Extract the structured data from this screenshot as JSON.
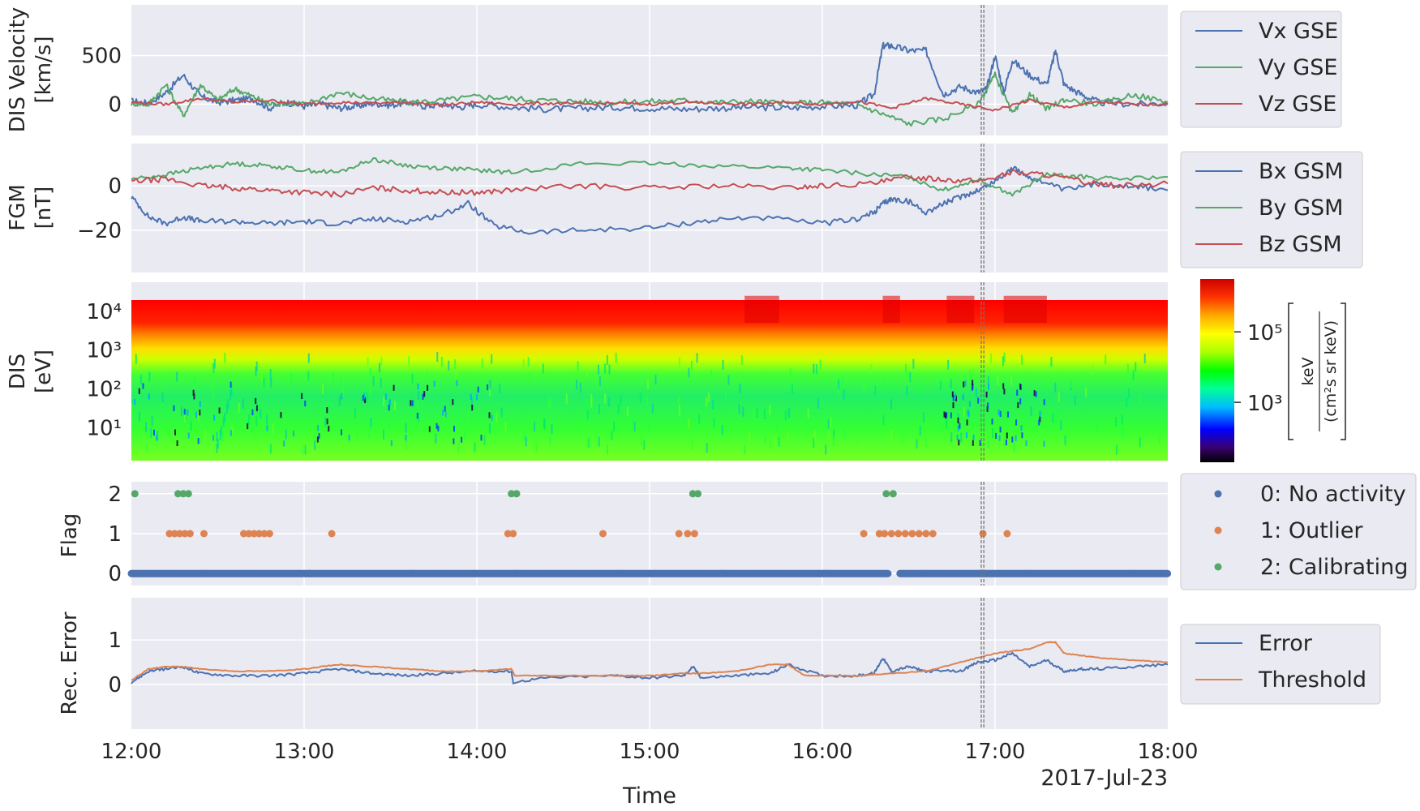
{
  "chart_data": {
    "type": "line",
    "x_label": "Time",
    "date_label": "2017-Jul-23",
    "x_ticks": [
      "12:00",
      "13:00",
      "14:00",
      "15:00",
      "16:00",
      "17:00",
      "18:00"
    ],
    "x_range_hours": [
      12.0,
      18.0
    ],
    "marker_lines_hours": [
      16.92,
      16.935
    ],
    "panels": [
      {
        "id": "dis-velocity",
        "ylabel": [
          "DIS Velocity",
          "[km/s]"
        ],
        "yticks": [
          "500",
          "0"
        ],
        "tick_values": [
          500,
          0
        ],
        "ylim": [
          -320,
          1020
        ],
        "series": [
          {
            "name": "Vx GSE",
            "color": "#4c72b0",
            "x": [
              12.0,
              12.1,
              12.2,
              12.3,
              12.4,
              12.5,
              12.6,
              12.7,
              12.8,
              12.9,
              13.0,
              13.1,
              13.2,
              13.3,
              13.4,
              13.5,
              13.6,
              13.7,
              13.8,
              13.9,
              14.0,
              14.2,
              14.4,
              14.6,
              14.8,
              15.0,
              15.2,
              15.4,
              15.6,
              15.8,
              16.0,
              16.2,
              16.3,
              16.35,
              16.4,
              16.5,
              16.6,
              16.7,
              16.8,
              16.9,
              16.95,
              17.0,
              17.05,
              17.1,
              17.2,
              17.3,
              17.35,
              17.4,
              17.5,
              17.6,
              17.8,
              18.0
            ],
            "y": [
              30,
              10,
              120,
              300,
              80,
              20,
              40,
              60,
              -40,
              20,
              -20,
              0,
              -40,
              -20,
              10,
              -10,
              20,
              -20,
              0,
              -30,
              0,
              -30,
              -50,
              -40,
              -30,
              -40,
              -50,
              -40,
              -30,
              -40,
              -20,
              -10,
              100,
              600,
              600,
              550,
              550,
              100,
              180,
              120,
              150,
              500,
              120,
              450,
              300,
              200,
              550,
              200,
              100,
              20,
              0,
              10
            ]
          },
          {
            "name": "Vy GSE",
            "color": "#55a868",
            "x": [
              12.0,
              12.1,
              12.2,
              12.3,
              12.4,
              12.5,
              12.6,
              12.7,
              12.8,
              12.9,
              13.0,
              13.2,
              13.4,
              13.6,
              13.8,
              14.0,
              14.2,
              14.4,
              14.6,
              14.8,
              15.0,
              15.2,
              15.4,
              15.6,
              15.8,
              16.0,
              16.2,
              16.35,
              16.5,
              16.7,
              16.9,
              17.0,
              17.1,
              17.2,
              17.3,
              17.4,
              17.6,
              17.8,
              18.0
            ],
            "y": [
              10,
              0,
              200,
              -120,
              200,
              40,
              160,
              80,
              0,
              20,
              0,
              120,
              60,
              20,
              40,
              80,
              60,
              40,
              30,
              20,
              30,
              40,
              20,
              30,
              10,
              20,
              0,
              -100,
              -200,
              -150,
              0,
              300,
              -100,
              100,
              -50,
              50,
              0,
              100,
              20
            ]
          },
          {
            "name": "Vz GSE",
            "color": "#c44e52",
            "x": [
              12.0,
              12.2,
              12.4,
              12.6,
              12.8,
              13.0,
              13.2,
              13.4,
              13.6,
              13.8,
              14.0,
              14.2,
              14.4,
              14.6,
              14.8,
              15.0,
              15.2,
              15.4,
              15.6,
              15.8,
              16.0,
              16.2,
              16.4,
              16.6,
              16.8,
              17.0,
              17.2,
              17.4,
              17.6,
              17.8,
              18.0
            ],
            "y": [
              20,
              0,
              60,
              20,
              40,
              0,
              20,
              10,
              20,
              -10,
              20,
              0,
              10,
              0,
              10,
              0,
              20,
              10,
              0,
              20,
              0,
              30,
              -40,
              60,
              0,
              -60,
              40,
              -30,
              20,
              0,
              0
            ]
          }
        ],
        "legend": [
          "Vx GSE",
          "Vy GSE",
          "Vz GSE"
        ]
      },
      {
        "id": "fgm",
        "ylabel": [
          "FGM",
          "[nT]"
        ],
        "yticks": [
          "0",
          "−20"
        ],
        "tick_values": [
          0,
          -20
        ],
        "ylim": [
          -39,
          19
        ],
        "series": [
          {
            "name": "Bx GSM",
            "color": "#4c72b0",
            "x": [
              12.0,
              12.1,
              12.2,
              12.3,
              12.4,
              12.6,
              12.8,
              13.0,
              13.2,
              13.4,
              13.6,
              13.8,
              13.95,
              14.1,
              14.3,
              14.6,
              15.0,
              15.3,
              15.6,
              16.0,
              16.2,
              16.3,
              16.35,
              16.4,
              16.5,
              16.6,
              16.7,
              16.8,
              16.9,
              17.0,
              17.1,
              17.2,
              17.4,
              17.6,
              17.8,
              18.0
            ],
            "y": [
              -5,
              -14,
              -17,
              -14,
              -16,
              -16,
              -17,
              -16,
              -17,
              -15,
              -16,
              -13,
              -8,
              -18,
              -21,
              -20,
              -19,
              -16,
              -14,
              -17,
              -15,
              -12,
              -8,
              -6,
              -7,
              -12,
              -8,
              -5,
              -2,
              2,
              8,
              4,
              -2,
              1,
              0,
              -2
            ]
          },
          {
            "name": "By GSM",
            "color": "#55a868",
            "x": [
              12.0,
              12.2,
              12.4,
              12.6,
              12.8,
              13.0,
              13.2,
              13.4,
              13.6,
              13.8,
              14.0,
              14.2,
              14.6,
              15.0,
              15.4,
              15.8,
              16.0,
              16.3,
              16.5,
              16.7,
              16.9,
              17.1,
              17.3,
              17.5,
              17.7,
              18.0
            ],
            "y": [
              3,
              5,
              8,
              10,
              9,
              7,
              6,
              12,
              9,
              8,
              7,
              6,
              10,
              10,
              9,
              8,
              7,
              5,
              4,
              -2,
              3,
              -4,
              5,
              4,
              3,
              4
            ]
          },
          {
            "name": "Bz GSM",
            "color": "#c44e52",
            "x": [
              12.0,
              12.2,
              12.4,
              12.6,
              12.8,
              13.0,
              13.2,
              13.4,
              13.6,
              13.8,
              14.0,
              14.2,
              14.6,
              15.0,
              15.4,
              15.8,
              16.0,
              16.3,
              16.5,
              16.7,
              16.9,
              17.1,
              17.3,
              17.5,
              17.7,
              18.0
            ],
            "y": [
              2,
              3,
              0,
              -1,
              -2,
              -3,
              -4,
              -1,
              -2,
              -3,
              -3,
              -2,
              0,
              -1,
              0,
              -1,
              0,
              1,
              4,
              3,
              2,
              6,
              5,
              2,
              0,
              1
            ]
          }
        ],
        "legend": [
          "Bx GSM",
          "By GSM",
          "Bz GSM"
        ]
      },
      {
        "id": "dis-spectrogram",
        "type": "heatmap",
        "ylabel": [
          "DIS",
          "[eV]"
        ],
        "yticks": [
          "10⁴",
          "10³",
          "10²",
          "10¹"
        ],
        "tick_values": [
          4,
          3,
          2,
          1
        ],
        "ylim_log10": [
          0.15,
          4.75
        ],
        "colorbar": {
          "label": [
            "keV",
            "(cm²s sr keV)"
          ],
          "ticks": [
            "10⁵",
            "10³"
          ],
          "tick_values": [
            5,
            3
          ],
          "range_log10": [
            1.3,
            6.5
          ],
          "colors": [
            "#000000",
            "#2a0060",
            "#0000ff",
            "#00aaff",
            "#00ffaa",
            "#00ff00",
            "#aaff00",
            "#ffff00",
            "#ffaa00",
            "#ff4400",
            "#ff0000",
            "#cc0000"
          ]
        }
      },
      {
        "id": "flag",
        "type": "scatter",
        "ylabel": [
          "Flag"
        ],
        "yticks": [
          "2",
          "1",
          "0"
        ],
        "tick_values": [
          2,
          1,
          0
        ],
        "ylim": [
          -0.3,
          2.3
        ],
        "series": [
          {
            "name": "0: No activity",
            "color": "#4c72b0",
            "level": 0,
            "ranges": [
              [
                12.0,
                16.38
              ],
              [
                16.45,
                18.0
              ]
            ]
          },
          {
            "name": "1: Outlier",
            "color": "#dd8452",
            "level": 1,
            "points": [
              12.22,
              12.25,
              12.28,
              12.31,
              12.34,
              12.42,
              12.65,
              12.68,
              12.71,
              12.74,
              12.77,
              12.8,
              13.16,
              14.18,
              14.21,
              14.73,
              15.17,
              15.22,
              15.26,
              16.24,
              16.33,
              16.36,
              16.4,
              16.44,
              16.48,
              16.52,
              16.56,
              16.6,
              16.64,
              16.93,
              17.07
            ]
          },
          {
            "name": "2: Calibrating",
            "color": "#55a868",
            "level": 2,
            "points": [
              12.02,
              12.27,
              12.3,
              12.33,
              14.2,
              14.23,
              15.25,
              15.28,
              16.37,
              16.41
            ]
          }
        ],
        "legend": [
          "0: No activity",
          "1: Outlier",
          "2: Calibrating"
        ]
      },
      {
        "id": "rec-error",
        "ylabel": [
          "Rec. Error"
        ],
        "yticks": [
          "1",
          "0"
        ],
        "tick_values": [
          1,
          0
        ],
        "ylim": [
          -1.0,
          1.95
        ],
        "series": [
          {
            "name": "Error",
            "color": "#4c72b0",
            "x": [
              12.0,
              12.1,
              12.2,
              12.3,
              12.4,
              12.6,
              12.8,
              13.0,
              13.2,
              13.4,
              13.6,
              13.8,
              14.0,
              14.2,
              14.21,
              14.4,
              14.8,
              15.0,
              15.2,
              15.25,
              15.3,
              15.5,
              15.7,
              15.8,
              16.0,
              16.2,
              16.3,
              16.35,
              16.4,
              16.5,
              16.6,
              16.8,
              16.9,
              17.0,
              17.1,
              17.2,
              17.3,
              17.4,
              17.5,
              17.6,
              17.8,
              18.0
            ],
            "y": [
              0.05,
              0.3,
              0.35,
              0.4,
              0.25,
              0.2,
              0.2,
              0.25,
              0.35,
              0.25,
              0.2,
              0.25,
              0.3,
              0.3,
              0.05,
              0.15,
              0.2,
              0.15,
              0.2,
              0.4,
              0.15,
              0.2,
              0.25,
              0.45,
              0.2,
              0.2,
              0.25,
              0.6,
              0.3,
              0.4,
              0.3,
              0.3,
              0.5,
              0.55,
              0.7,
              0.4,
              0.55,
              0.3,
              0.35,
              0.35,
              0.4,
              0.45
            ]
          },
          {
            "name": "Threshold",
            "color": "#dd8452",
            "x": [
              12.0,
              12.1,
              12.2,
              12.3,
              12.4,
              12.6,
              12.8,
              13.0,
              13.2,
              13.4,
              13.6,
              13.8,
              14.0,
              14.2,
              14.22,
              14.4,
              14.8,
              15.0,
              15.2,
              15.3,
              15.5,
              15.7,
              15.8,
              15.9,
              16.0,
              16.2,
              16.4,
              16.6,
              16.8,
              16.9,
              17.0,
              17.1,
              17.2,
              17.3,
              17.35,
              17.4,
              17.5,
              17.6,
              17.8,
              18.0
            ],
            "y": [
              0.1,
              0.35,
              0.4,
              0.4,
              0.35,
              0.3,
              0.3,
              0.35,
              0.45,
              0.4,
              0.35,
              0.3,
              0.3,
              0.35,
              0.2,
              0.2,
              0.2,
              0.2,
              0.25,
              0.25,
              0.3,
              0.45,
              0.45,
              0.2,
              0.2,
              0.2,
              0.25,
              0.3,
              0.5,
              0.6,
              0.7,
              0.75,
              0.8,
              0.95,
              0.95,
              0.7,
              0.65,
              0.6,
              0.55,
              0.5
            ]
          }
        ],
        "legend": [
          "Error",
          "Threshold"
        ]
      }
    ]
  }
}
